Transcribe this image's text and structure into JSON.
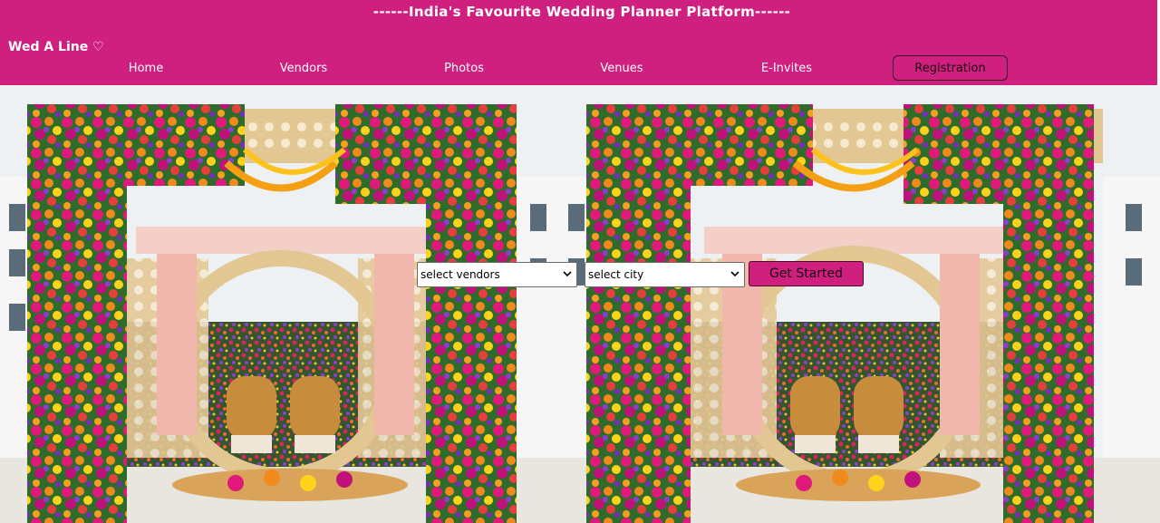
{
  "header": {
    "tagline": "------India's Favourite Wedding Planner Platform------",
    "brand": "Wed A Line ♡",
    "nav": [
      {
        "label": "Home"
      },
      {
        "label": "Vendors"
      },
      {
        "label": "Photos"
      },
      {
        "label": "Venues"
      },
      {
        "label": "E-Invites"
      }
    ],
    "registration_label": "Registration"
  },
  "search": {
    "vendors_select": {
      "selected": "select vendors"
    },
    "city_select": {
      "selected": "select city"
    },
    "submit_label": "Get Started"
  },
  "hero": {
    "image_subject": "floral-mandap-photo"
  },
  "colors": {
    "brand_pink": "#cf2080",
    "header_text": "#ffffff"
  }
}
